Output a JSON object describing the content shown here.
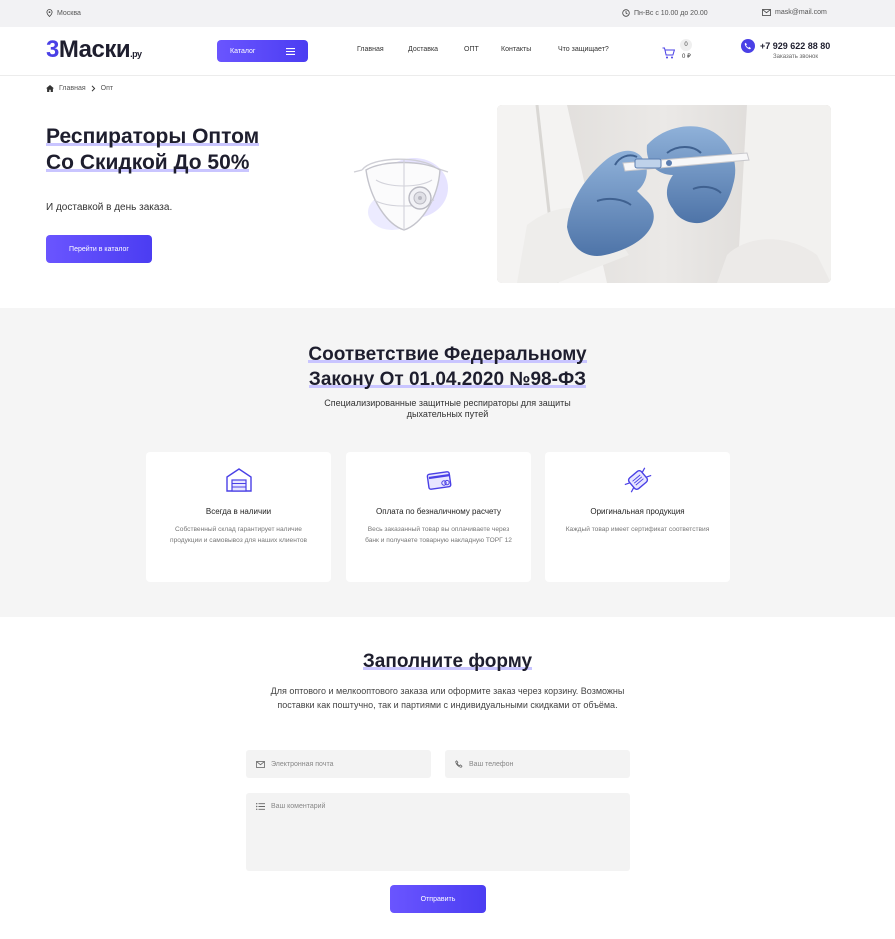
{
  "topbar": {
    "city": "Москва",
    "hours": "Пн-Вс с 10.00 до 20.00",
    "email": "mask@mail.com"
  },
  "header": {
    "logo_num": "3",
    "logo_text": "Маски",
    "logo_suffix": ".ру",
    "catalog_label": "Каталог",
    "nav": [
      "Главная",
      "Доставка",
      "ОПТ",
      "Контакты",
      "Что защищает?"
    ],
    "cart_count": "0",
    "cart_sum": "0 ₽",
    "phone": "+7 929 622 88 80",
    "callback": "Заказать звонок"
  },
  "breadcrumb": {
    "home": "Главная",
    "current": "Опт"
  },
  "hero": {
    "title_line1": "Респираторы Оптом",
    "title_line2": "Со Скидкой До 50%",
    "subtitle": "И доставкой в день заказа.",
    "button": "Перейти в каталог"
  },
  "features": {
    "title_line1": "Соответствие Федеральному",
    "title_line2": "Закону От 01.04.2020 №98-ФЗ",
    "subtitle_line1": "Специализированные защитные респираторы для защиты",
    "subtitle_line2": "дыхательных путей",
    "cards": [
      {
        "icon": "warehouse-icon",
        "title": "Всегда в наличии",
        "text": "Собственный склад гарантирует наличие продукции и самовывоз для наших клиентов"
      },
      {
        "icon": "payment-card-icon",
        "title": "Оплата по безналичному расчету",
        "text": "Весь заказанный товар вы оплачиваете через банк и получаете товарную накладную ТОРГ 12"
      },
      {
        "icon": "mask-icon",
        "title": "Оригинальная продукция",
        "text": "Каждый товар имеет сертификат соответствия"
      }
    ]
  },
  "form": {
    "title": "Заполните форму",
    "subtitle": "Для оптового и мелкооптового заказа или оформите заказ через корзину. Возможны поставки как поштучно, так и партиями с индивидуальными скидками от объёма.",
    "email_placeholder": "Электронная почта",
    "phone_placeholder": "Ваш телефон",
    "comment_placeholder": "Ваш коментарий",
    "submit": "Отправить"
  },
  "colors": {
    "accent": "#4a40e6",
    "section_bg": "#f5f5f5",
    "highlight": "#c9c5ff"
  }
}
